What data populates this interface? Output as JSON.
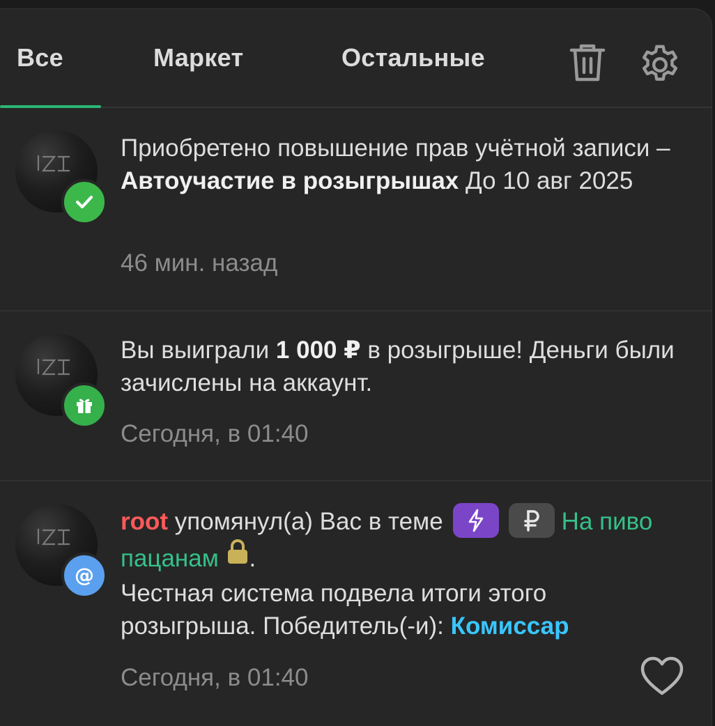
{
  "tabs": [
    {
      "label": "Все",
      "active": true
    },
    {
      "label": "Маркет",
      "active": false
    },
    {
      "label": "Остальные",
      "active": false
    }
  ],
  "toolbar": {
    "delete_icon": "trash-icon",
    "settings_icon": "gear-icon"
  },
  "colors": {
    "accent": "#2bb673",
    "success_badge": "#3cb84a",
    "gift_badge": "#35b04b",
    "mention_badge": "#5aa0ee",
    "username": "#ff5a5a",
    "thread_link": "#35c08a",
    "winner": "#39c6ff",
    "prefix_purple": "#7b45c8",
    "prefix_gray": "#4a4a4a",
    "lock": "#c9b15a"
  },
  "notifications": [
    {
      "badge_icon": "check-icon",
      "text_start": "Приобретено повышение прав учётной записи – ",
      "text_bold": "Автоучастие в розыгрышах",
      "text_end": " До 10 авг 2025",
      "time": "46 мин. назад"
    },
    {
      "badge_icon": "gift-icon",
      "text_start": "Вы выиграли ",
      "text_bold": "1 000 ₽",
      "text_end": " в розыгрыше! Деньги были зачислены на аккаунт.",
      "time": "Сегодня, в 01:40"
    },
    {
      "badge_icon": "at-icon",
      "username": "root",
      "action": " упомянул(а) Вас в теме",
      "prefix_1_icon": "lightning-icon",
      "prefix_2_icon": "ruble-icon",
      "thread_title": "На пиво пацанам",
      "lock_icon": "lock-icon",
      "period": ".",
      "message": "Честная система подвела итоги этого розыгрыша. Победитель(-и): ",
      "winner": "Комиссар",
      "time": "Сегодня, в 01:40",
      "like_icon": "heart-icon"
    }
  ]
}
